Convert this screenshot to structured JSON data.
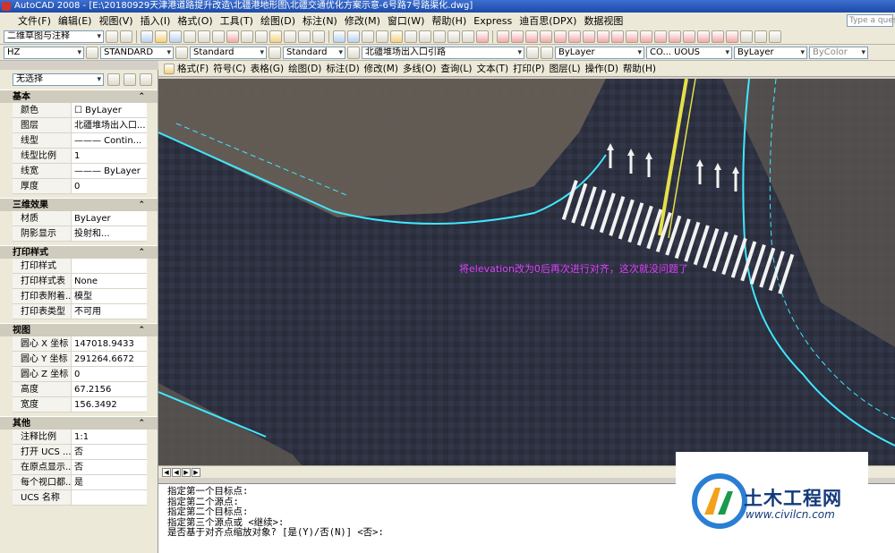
{
  "window": {
    "title": "AutoCAD 2008 - [E:\\20180929天津港道路提升改造\\北疆港地形图\\北疆交通优化方案示意-6号路7号路渠化.dwg]"
  },
  "menubar": {
    "items": [
      "文件(F)",
      "编辑(E)",
      "视图(V)",
      "插入(I)",
      "格式(O)",
      "工具(T)",
      "绘图(D)",
      "标注(N)",
      "修改(M)",
      "窗口(W)",
      "帮助(H)",
      "Express",
      "迪百思(DPX)",
      "数据视图"
    ],
    "help_placeholder": "Type a quest"
  },
  "toolbar1": {
    "workspace": "二维草图与注释"
  },
  "toolbar2": {
    "font": "HZ",
    "textstyle": "STANDARD",
    "dimstyle": "Standard",
    "tablestyle": "Standard",
    "layer": "北疆堆场出入口引路",
    "color": "ByLayer",
    "linetype": "CO... UOUS",
    "lineweight": "ByLayer",
    "plotstyle": "ByColor"
  },
  "cadmenu": {
    "items": [
      "格式(F)",
      "符号(C)",
      "表格(G)",
      "绘图(D)",
      "标注(D)",
      "修改(M)",
      "多线(O)",
      "查询(L)",
      "文本(T)",
      "打印(P)",
      "图层(L)",
      "操作(D)",
      "帮助(H)"
    ]
  },
  "properties": {
    "selection": "无选择",
    "sections": [
      {
        "title": "基本",
        "rows": [
          {
            "k": "颜色",
            "v": "☐ ByLayer"
          },
          {
            "k": "图层",
            "v": "北疆堆场出入口..."
          },
          {
            "k": "线型",
            "v": "——— Contin..."
          },
          {
            "k": "线型比例",
            "v": "1"
          },
          {
            "k": "线宽",
            "v": "——— ByLayer"
          },
          {
            "k": "厚度",
            "v": "0"
          }
        ]
      },
      {
        "title": "三维效果",
        "rows": [
          {
            "k": "材质",
            "v": "ByLayer"
          },
          {
            "k": "阴影显示",
            "v": "投射和..."
          }
        ]
      },
      {
        "title": "打印样式",
        "rows": [
          {
            "k": "打印样式",
            "v": ""
          },
          {
            "k": "打印样式表",
            "v": "None"
          },
          {
            "k": "打印表附着...",
            "v": "模型"
          },
          {
            "k": "打印表类型",
            "v": "不可用"
          }
        ]
      },
      {
        "title": "视图",
        "rows": [
          {
            "k": "圆心 X 坐标",
            "v": "147018.9433"
          },
          {
            "k": "圆心 Y 坐标",
            "v": "291264.6672"
          },
          {
            "k": "圆心 Z 坐标",
            "v": "0"
          },
          {
            "k": "高度",
            "v": "67.2156"
          },
          {
            "k": "宽度",
            "v": "156.3492"
          }
        ]
      },
      {
        "title": "其他",
        "rows": [
          {
            "k": "注释比例",
            "v": "1:1"
          },
          {
            "k": "打开 UCS ...",
            "v": "否"
          },
          {
            "k": "在原点显示...",
            "v": "否"
          },
          {
            "k": "每个视口都...",
            "v": "是"
          },
          {
            "k": "UCS 名称",
            "v": ""
          }
        ]
      }
    ]
  },
  "drawing": {
    "annotation": "将elevation改为0后再次进行对齐，这次就没问题了"
  },
  "command": {
    "lines": [
      "指定第一个目标点:",
      "指定第二个源点:",
      "指定第二个目标点:",
      "指定第三个源点或 <继续>:",
      "是否基于对齐点缩放对象? [是(Y)/否(N)] <否>:"
    ]
  },
  "watermark": {
    "name": "土木工程网",
    "url": "www.civilcn.com"
  },
  "colors": {
    "annotation": "#e040ff",
    "cyan_line": "#40e8ff",
    "yellow_line": "#e6e04a"
  }
}
